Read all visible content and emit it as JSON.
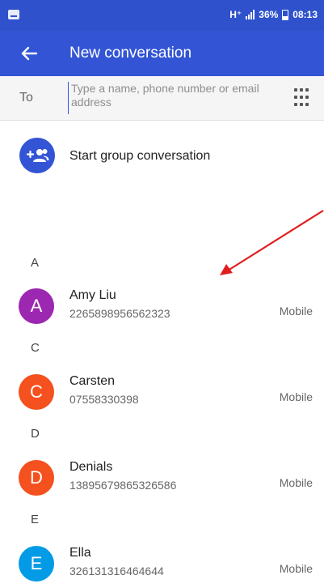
{
  "status_bar": {
    "network": "H⁺",
    "battery_percent": "36%",
    "time": "08:13"
  },
  "app_bar": {
    "title": "New conversation",
    "back_icon": "arrow-left-icon"
  },
  "to_field": {
    "label": "To",
    "placeholder": "Type a name, phone number or email address",
    "value": "",
    "dialpad_icon": "dialpad-icon"
  },
  "group": {
    "label": "Start group conversation",
    "icon": "group-add-icon"
  },
  "contacts": [
    {
      "letter": "A",
      "initial": "A",
      "name": "Amy Liu",
      "number": "2265898956562323",
      "type": "Mobile",
      "color": "#9c27b0"
    },
    {
      "letter": "C",
      "initial": "C",
      "name": "Carsten",
      "number": "07558330398",
      "type": "Mobile",
      "color": "#f4511e"
    },
    {
      "letter": "D",
      "initial": "D",
      "name": "Denials",
      "number": "13895679865326586",
      "type": "Mobile",
      "color": "#f4511e"
    },
    {
      "letter": "E",
      "initial": "E",
      "name": "Ella",
      "number": "326131316464644",
      "type": "Mobile",
      "color": "#039be5"
    }
  ],
  "colors": {
    "status_bar": "#2f52cc",
    "app_bar": "#3355d5",
    "annotation_arrow": "#e01e1e"
  }
}
